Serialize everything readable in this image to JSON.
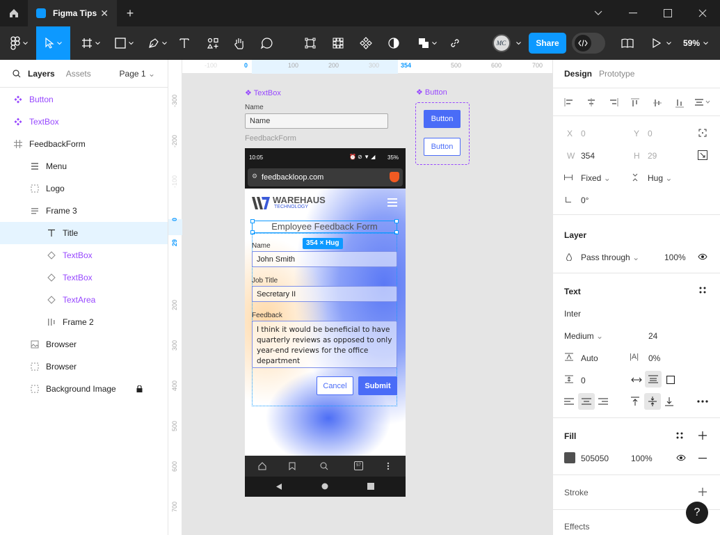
{
  "app": {
    "tab_title": "Figma Tips",
    "share_label": "Share",
    "zoom_level": "59%",
    "avatar_initials": "MC"
  },
  "left_panel": {
    "tabs": [
      "Layers",
      "Assets"
    ],
    "page": "Page 1",
    "layers": [
      {
        "label": "Button",
        "type": "component"
      },
      {
        "label": "TextBox",
        "type": "component"
      },
      {
        "label": "FeedbackForm",
        "type": "frame"
      },
      {
        "label": "Menu",
        "type": "layout"
      },
      {
        "label": "Logo",
        "type": "group"
      },
      {
        "label": "Frame 3",
        "type": "stack"
      },
      {
        "label": "Title",
        "type": "text"
      },
      {
        "label": "TextBox",
        "type": "instance"
      },
      {
        "label": "TextBox",
        "type": "instance"
      },
      {
        "label": "TextArea",
        "type": "instance"
      },
      {
        "label": "Frame 2",
        "type": "hstack"
      },
      {
        "label": "Browser",
        "type": "image"
      },
      {
        "label": "Browser",
        "type": "group"
      },
      {
        "label": "Background Image",
        "type": "group"
      }
    ]
  },
  "rulers": {
    "top": [
      "-100",
      "0",
      "100",
      "200",
      "300",
      "354",
      "500",
      "600",
      "700"
    ],
    "left": [
      "-300",
      "-200",
      "-100",
      "0",
      "29",
      "200",
      "300",
      "400",
      "500",
      "600",
      "700"
    ]
  },
  "canvas": {
    "textbox_component_label": "TextBox",
    "button_component_label": "Button",
    "textbox_demo": {
      "label": "Name",
      "value": "Name"
    },
    "button_primary": "Button",
    "button_secondary": "Button",
    "feedback_frame_label": "FeedbackForm",
    "phone": {
      "time": "10:05",
      "battery": "35%",
      "url": "feedbackloop.com",
      "logo_main": "WAREHAUS",
      "logo_sub": "TECHNOLOGY",
      "form_title": "Employee Feedback Form",
      "size_badge": "354 × Hug",
      "fields": [
        {
          "label": "Name",
          "value": "John Smith"
        },
        {
          "label": "Job Title",
          "value": "Secretary II"
        }
      ],
      "feedback": {
        "label": "Feedback",
        "value": "I think it would be beneficial to have quarterly reviews as opposed to only year-end reviews for the office department"
      },
      "cancel_label": "Cancel",
      "submit_label": "Submit",
      "tab_count": "57"
    }
  },
  "right_panel": {
    "tabs": [
      "Design",
      "Prototype"
    ],
    "x_label": "X",
    "x_value": "0",
    "y_label": "Y",
    "y_value": "0",
    "w_label": "W",
    "w_value": "354",
    "h_label": "H",
    "h_value": "29",
    "width_mode": "Fixed",
    "height_mode": "Hug",
    "rotation": "0°",
    "layer_title": "Layer",
    "blend_mode": "Pass through",
    "opacity": "100%",
    "text_title": "Text",
    "font_family": "Inter",
    "font_weight": "Medium",
    "font_size": "24",
    "line_height": "Auto",
    "letter_spacing": "0%",
    "paragraph_spacing": "0",
    "fill_title": "Fill",
    "fill_color": "505050",
    "fill_opacity": "100%",
    "stroke_title": "Stroke",
    "effects_title": "Effects",
    "help": "?"
  },
  "colors": {
    "accent": "#0d99ff",
    "component": "#9747ff",
    "submit": "#4a6cf7",
    "fill_swatch": "#505050"
  }
}
